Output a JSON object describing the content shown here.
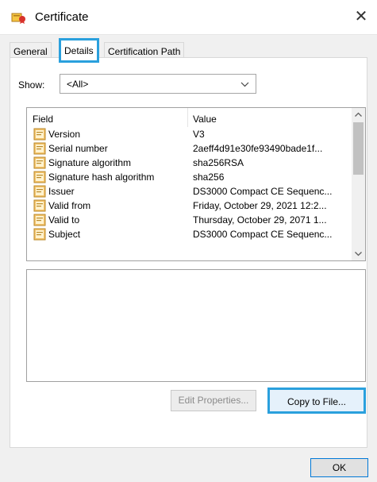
{
  "window": {
    "title": "Certificate",
    "close_glyph": "✕",
    "icon": "certificate-icon"
  },
  "tabs": [
    {
      "label": "General",
      "selected": false
    },
    {
      "label": "Details",
      "selected": true
    },
    {
      "label": "Certification Path",
      "selected": false
    }
  ],
  "show": {
    "label": "Show:",
    "selected_value": "<All>"
  },
  "list": {
    "columns": {
      "field": "Field",
      "value": "Value"
    },
    "rows": [
      {
        "field": "Version",
        "value": "V3"
      },
      {
        "field": "Serial number",
        "value": "2aeff4d91e30fe93490bade1f..."
      },
      {
        "field": "Signature algorithm",
        "value": "sha256RSA"
      },
      {
        "field": "Signature hash algorithm",
        "value": "sha256"
      },
      {
        "field": "Issuer",
        "value": "DS3000 Compact CE Sequenc..."
      },
      {
        "field": "Valid from",
        "value": "Friday, October 29, 2021 12:2..."
      },
      {
        "field": "Valid to",
        "value": "Thursday, October 29, 2071 1..."
      },
      {
        "field": "Subject",
        "value": "DS3000 Compact CE Sequenc..."
      }
    ]
  },
  "buttons": {
    "edit_properties": "Edit Properties...",
    "copy_to_file": "Copy to File...",
    "ok": "OK"
  },
  "colors": {
    "highlight": "#2aa0dd",
    "window_bg": "#f0f0f0",
    "panel_bg": "#ffffff",
    "disabled_text": "#8a8a8a"
  }
}
